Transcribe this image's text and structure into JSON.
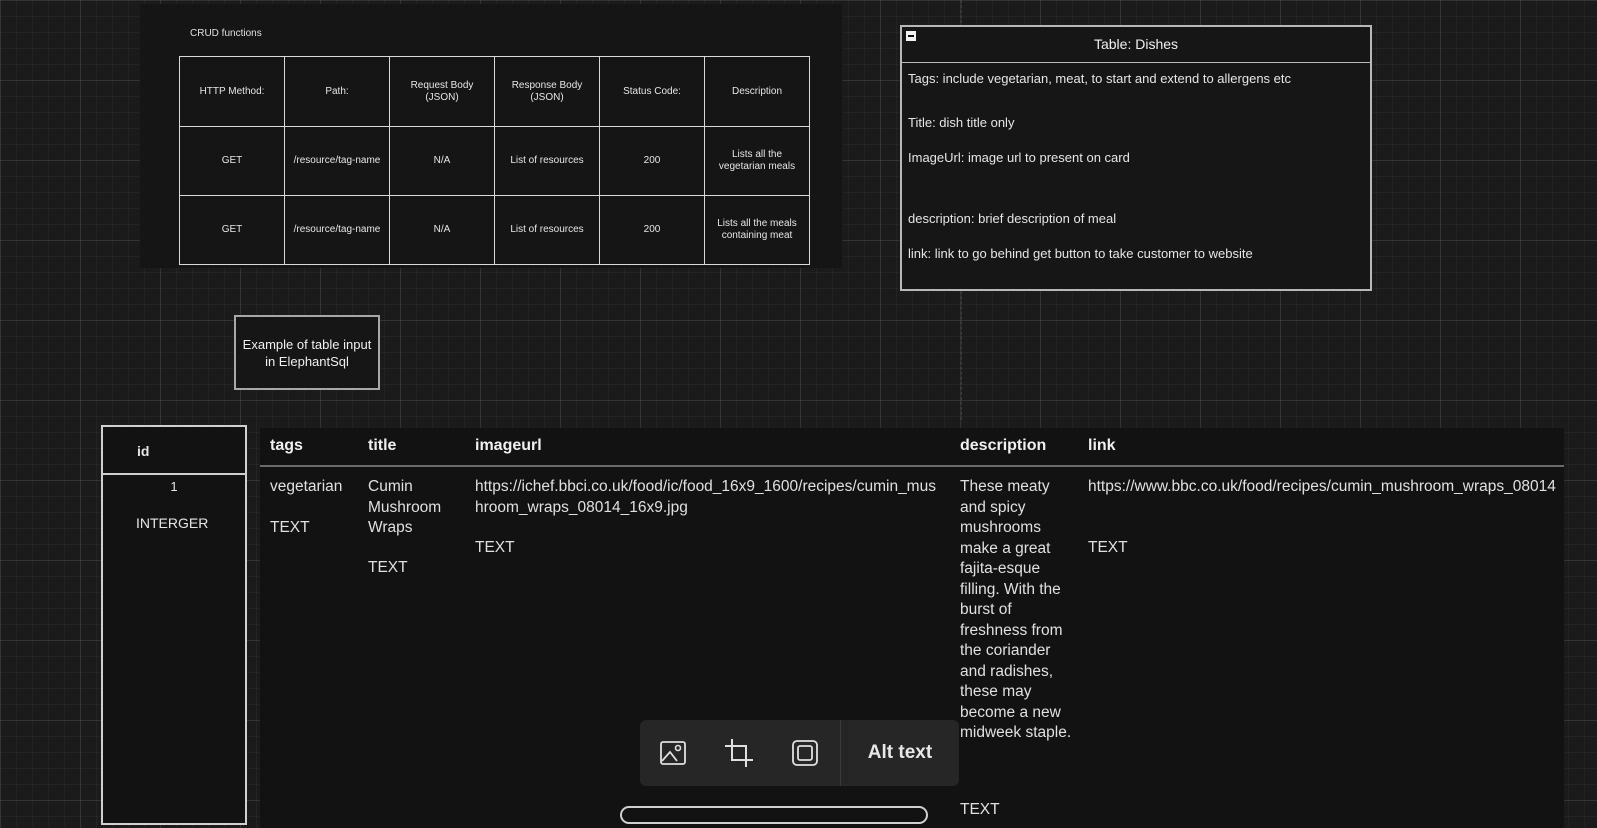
{
  "crud": {
    "title": "CRUD functions",
    "headers": [
      "HTTP Method:",
      "Path:",
      "Request Body (JSON)",
      "Response Body (JSON)",
      "Status Code:",
      "Description"
    ],
    "rows": [
      [
        "GET",
        "/resource/tag-name",
        "N/A",
        "List of resources",
        "200",
        "Lists all the vegetarian meals"
      ],
      [
        "GET",
        "/resource/tag-name",
        "N/A",
        "List of resources",
        "200",
        "Lists all the meals containing meat"
      ]
    ]
  },
  "dishes": {
    "title": "Table: Dishes",
    "fields": [
      "Tags: include vegetarian, meat, to start and extend to allergens etc",
      "Title: dish title only",
      "ImageUrl: image url to present on card",
      "description: brief description of meal",
      "link: link to go behind get button to take customer to website"
    ]
  },
  "note": "Example of table input in ElephantSql",
  "db": {
    "id": {
      "header": "id",
      "value": "1",
      "type": "INTERGER"
    },
    "headers": {
      "tags": "tags",
      "title": "title",
      "imageurl": "imageurl",
      "description": "description",
      "link": "link"
    },
    "row": {
      "tags": "vegetarian",
      "tags_type": "TEXT",
      "title": "Cumin Mushroom Wraps",
      "title_type": "TEXT",
      "imageurl": "https://ichef.bbci.co.uk/food/ic/food_16x9_1600/recipes/cumin_mushroom_wraps_08014_16x9.jpg",
      "imageurl_type": "TEXT",
      "description": "These meaty and spicy mushrooms make a great fajita-esque filling. With the burst of freshness from the coriander and radishes, these may become a new midweek staple.",
      "description_type": "TEXT",
      "link": "https://www.bbc.co.uk/food/recipes/cumin_mushroom_wraps_08014",
      "link_type": "TEXT"
    }
  },
  "toolbar": {
    "icons": [
      "image-icon",
      "crop-icon",
      "frame-icon"
    ],
    "alt_text_label": "Alt text"
  }
}
